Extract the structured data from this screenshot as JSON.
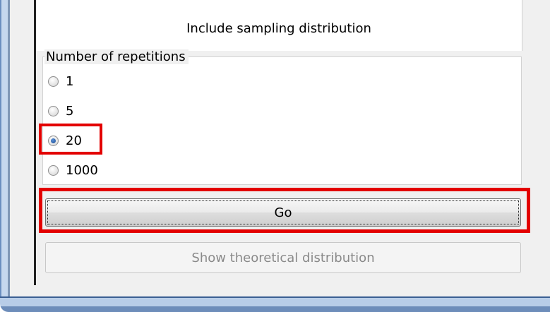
{
  "tab": {
    "title": "Include sampling distribution"
  },
  "repetitions": {
    "legend": "Number of repetitions",
    "options": [
      "1",
      "5",
      "20",
      "1000"
    ],
    "selected": "20"
  },
  "buttons": {
    "go": "Go",
    "show_theoretical": "Show theoretical distribution"
  },
  "colors": {
    "highlight": "#e30000",
    "window_frame": "#6d8dba"
  }
}
